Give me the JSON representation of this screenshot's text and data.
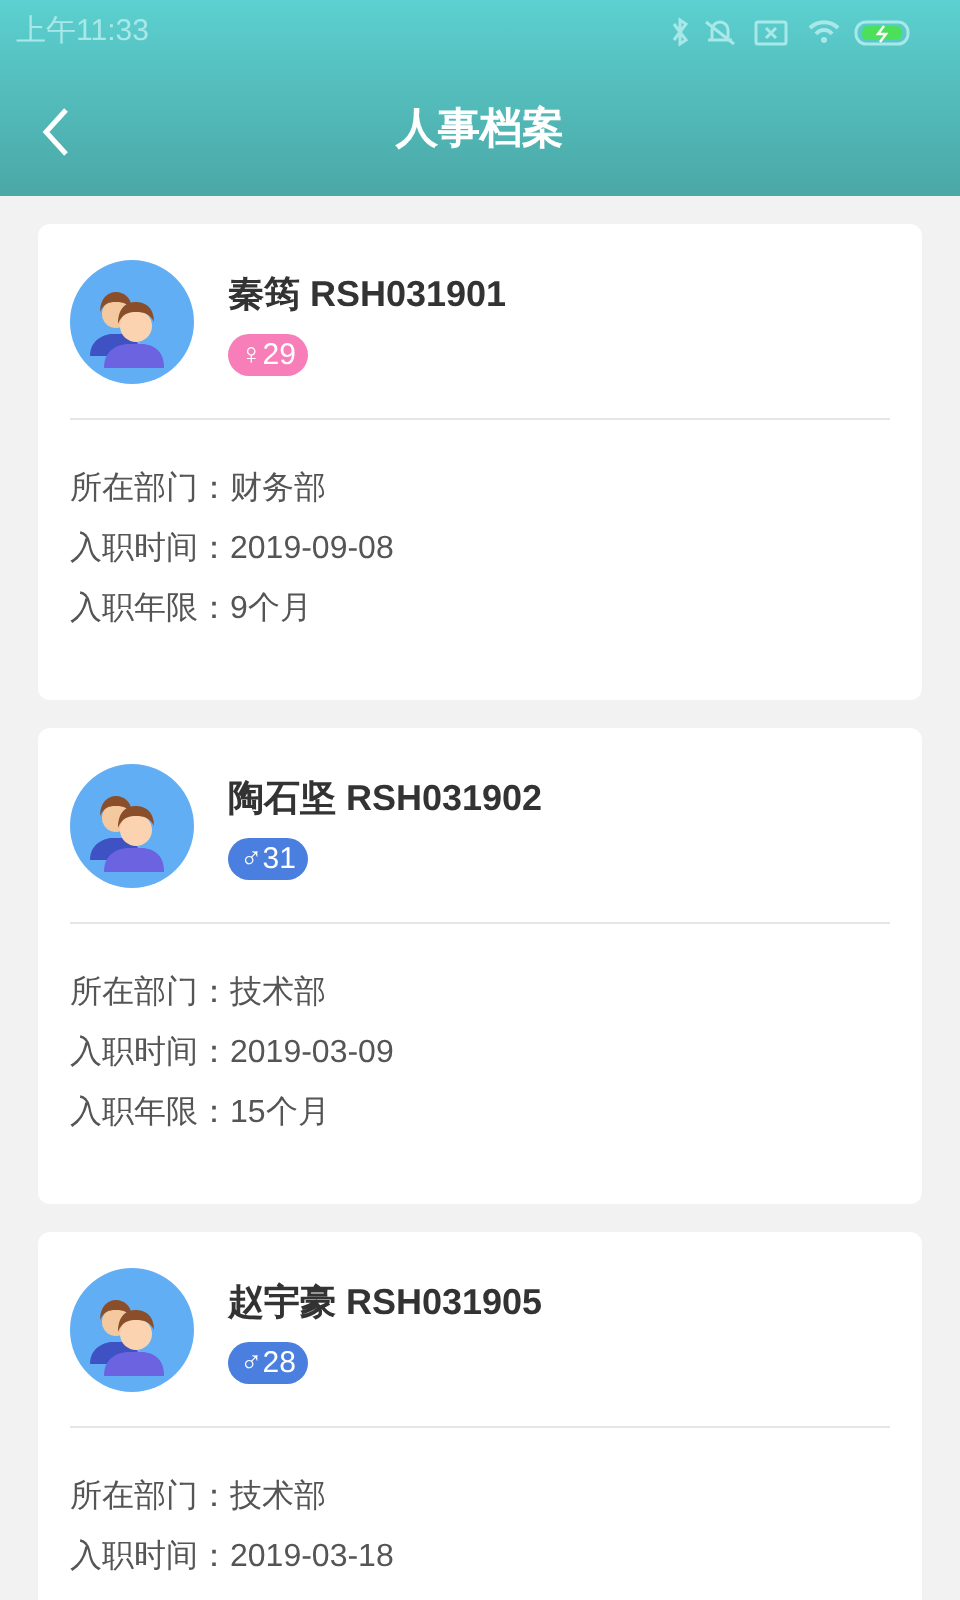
{
  "status_bar": {
    "time": "上午11:33"
  },
  "header": {
    "title": "人事档案"
  },
  "employees": [
    {
      "name": "秦筠 RSH031901",
      "gender": {
        "kind": "female",
        "symbol": "♀",
        "age": "29"
      },
      "fields": [
        {
          "label": "所在部门：",
          "value": "财务部"
        },
        {
          "label": "入职时间：",
          "value": "2019-09-08"
        },
        {
          "label": "入职年限：",
          "value": "9个月"
        }
      ]
    },
    {
      "name": "陶石坚 RSH031902",
      "gender": {
        "kind": "male",
        "symbol": "♂",
        "age": "31"
      },
      "fields": [
        {
          "label": "所在部门：",
          "value": "技术部"
        },
        {
          "label": "入职时间：",
          "value": "2019-03-09"
        },
        {
          "label": "入职年限：",
          "value": "15个月"
        }
      ]
    },
    {
      "name": "赵宇豪 RSH031905",
      "gender": {
        "kind": "male",
        "symbol": "♂",
        "age": "28"
      },
      "fields": [
        {
          "label": "所在部门：",
          "value": "技术部"
        },
        {
          "label": "入职时间：",
          "value": "2019-03-18"
        }
      ]
    }
  ]
}
